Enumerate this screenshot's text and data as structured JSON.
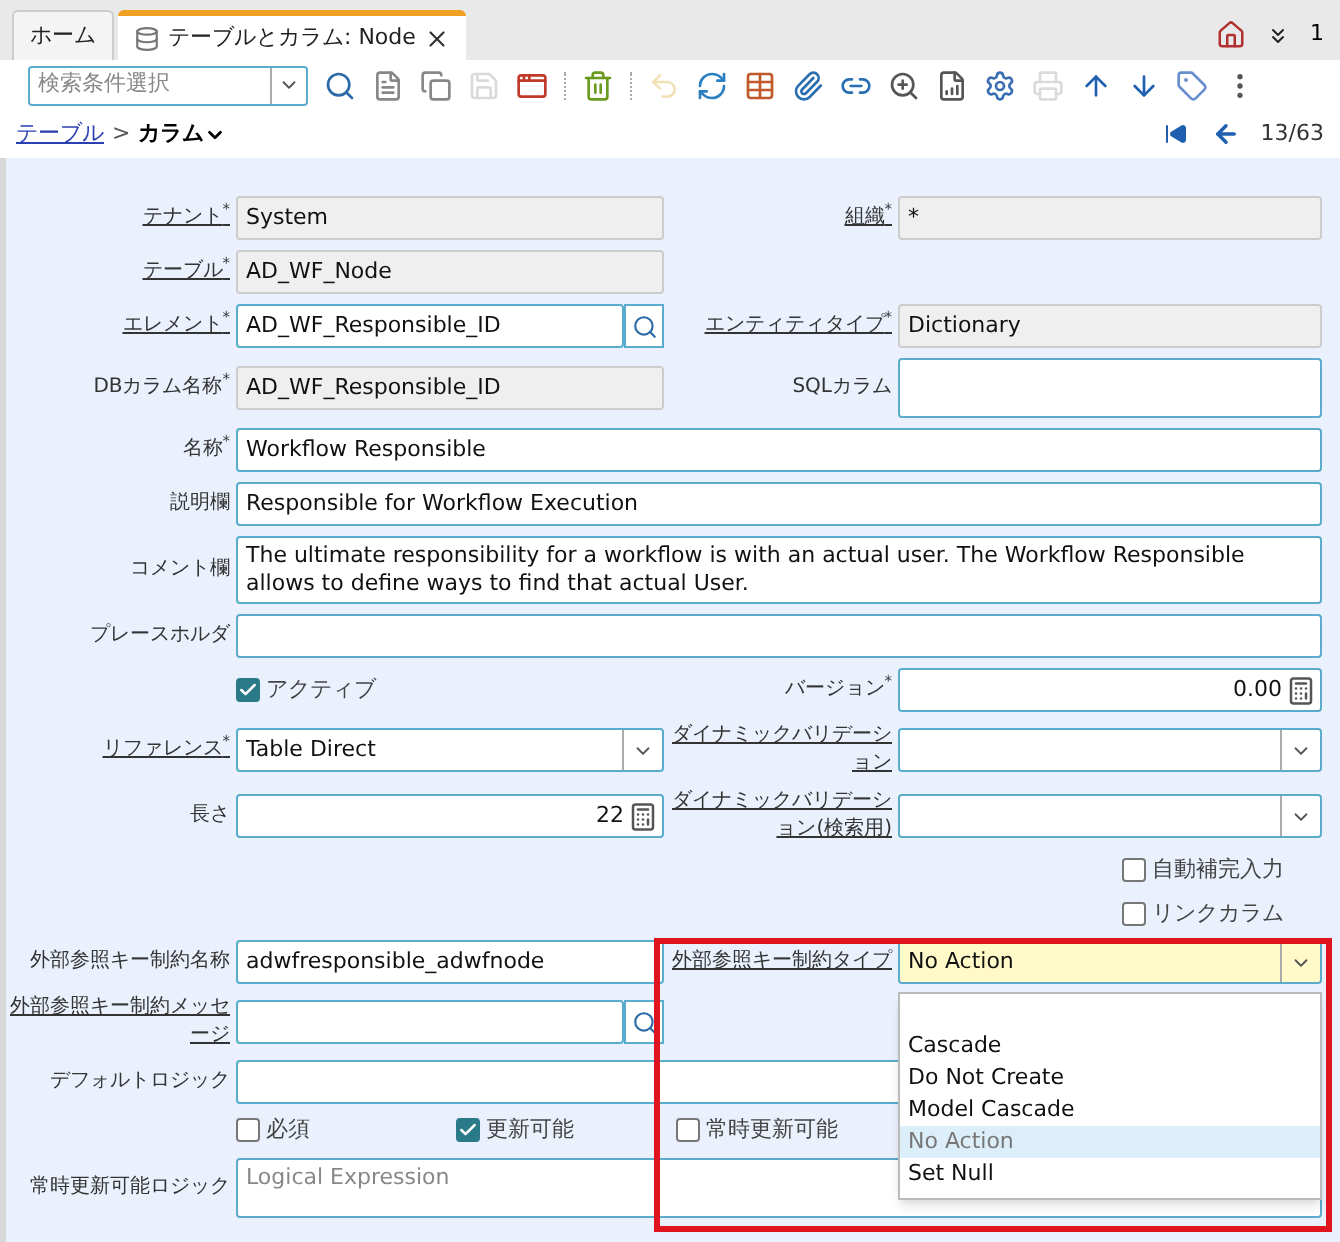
{
  "tabs": [
    {
      "label": "ホーム",
      "selected": false
    },
    {
      "label": "テーブルとカラム: Node",
      "selected": true
    }
  ],
  "window_count": "1",
  "toolbar": {
    "search": {
      "placeholder": "検索条件選択"
    },
    "buttons": [
      {
        "kind": "find",
        "disabled": false
      },
      {
        "kind": "new",
        "disabled": false
      },
      {
        "kind": "copy",
        "disabled": false
      },
      {
        "kind": "save",
        "disabled": true
      },
      {
        "kind": "new-window",
        "disabled": false
      },
      {
        "kind": "sep"
      },
      {
        "kind": "delete",
        "disabled": false
      },
      {
        "kind": "sep"
      },
      {
        "kind": "undo",
        "disabled": true
      },
      {
        "kind": "refresh",
        "disabled": false
      },
      {
        "kind": "grid",
        "disabled": false
      },
      {
        "kind": "attach",
        "disabled": false
      },
      {
        "kind": "attach-up",
        "disabled": false
      },
      {
        "kind": "zoom-across",
        "disabled": false
      },
      {
        "kind": "report",
        "disabled": false
      },
      {
        "kind": "process",
        "disabled": false
      },
      {
        "kind": "print",
        "disabled": true
      },
      {
        "kind": "up",
        "disabled": false
      },
      {
        "kind": "down",
        "disabled": false
      },
      {
        "kind": "tag",
        "disabled": false
      },
      {
        "kind": "more",
        "disabled": false
      }
    ]
  },
  "breadcrumb": {
    "parent": "テーブル",
    "separator": ">",
    "current": "カラム"
  },
  "record_nav": "13/63",
  "form": {
    "rows": [
      {
        "left": {
          "label": "テナント$^{*}$",
          "link": true,
          "kind": "readonly",
          "value": "System"
        },
        "right": {
          "label": "組織$^{*}$",
          "link": true,
          "kind": "readonly",
          "value": "*"
        }
      },
      {
        "left": {
          "label": "テーブル$^{*}$",
          "link": true,
          "kind": "readonly",
          "value": "AD_WF_Node"
        }
      },
      {
        "left": {
          "label": "エレメント$^{*}$",
          "link": true,
          "kind": "search",
          "value": "AD_WF_Responsible_ID"
        },
        "right": {
          "label": "エンティティタイプ$^{*}$",
          "link": true,
          "kind": "readonly",
          "value": "Dictionary"
        }
      },
      {
        "left": {
          "label": "DBカラム名称$^{*}$",
          "link": false,
          "kind": "readonly",
          "value": "AD_WF_Responsible_ID"
        },
        "right": {
          "label": "SQLカラム",
          "link": false,
          "kind": "textarea"
        }
      },
      {
        "full": {
          "label": "名称$^{*}$",
          "link": false,
          "kind": "text",
          "value": "Workflow Responsible"
        }
      },
      {
        "full": {
          "label": "説明欄",
          "link": false,
          "kind": "text",
          "value": "Responsible for Workflow Execution"
        }
      },
      {
        "full": {
          "label": "コメント欄",
          "link": false,
          "kind": "textarea",
          "value": "The ultimate responsibility for a workflow is with an actual user. The Workflow Responsible allows to define ways to find that actual User."
        }
      },
      {
        "full": {
          "label": "プレースホルダ",
          "link": false,
          "kind": "text"
        }
      },
      {
        "left": {
          "kind": "checkbox",
          "label": "アクティブ",
          "checked": true
        },
        "right": {
          "label": "バージョン$^{*}$",
          "link": false,
          "kind": "number",
          "value": "0.00"
        }
      },
      {
        "left": {
          "label": "リファレンス$^{*}$",
          "link": true,
          "kind": "select",
          "value": "Table Direct"
        },
        "right": {
          "label": "ダイナミックバリデーション",
          "link": true,
          "kind": "select"
        }
      },
      {
        "left": {
          "label": "長さ",
          "link": false,
          "kind": "number",
          "value": "22"
        },
        "right": {
          "label": "ダイナミックバリデーション(検索用)",
          "link": true,
          "kind": "select"
        }
      },
      {
        "right": {
          "kind": "checkbox",
          "label": "自動補完入力",
          "checked": false
        }
      },
      {
        "right": {
          "kind": "checkbox",
          "label": "リンクカラム",
          "checked": false
        }
      },
      {
        "left": {
          "label": "外部参照キー制約名称",
          "link": false,
          "kind": "text",
          "value": "adwfresponsible_adwfnode"
        },
        "right": {
          "label": "外部参照キー制約タイプ",
          "link": true,
          "kind": "select",
          "value": "No Action",
          "open": true,
          "outlined": true,
          "options": [
            {
              "label": "Cascade",
              "selected": false
            },
            {
              "label": "Do Not Create",
              "selected": false
            },
            {
              "label": "Model Cascade",
              "selected": false
            },
            {
              "label": "No Action",
              "selected": true
            },
            {
              "label": "Set Null",
              "selected": false
            }
          ]
        }
      },
      {
        "left": {
          "label": "外部参照キー制約メッセージ",
          "link": true,
          "kind": "search"
        }
      },
      {
        "full": {
          "label": "デフォルトロジック",
          "link": false,
          "kind": "text"
        }
      },
      {
        "checks": [
          {
            "kind": "checkbox",
            "label": "必須",
            "checked": false
          },
          {
            "kind": "checkbox",
            "label": "更新可能",
            "checked": true
          },
          {
            "kind": "checkbox",
            "label": "常時更新可能",
            "checked": false
          }
        ]
      },
      {
        "full": {
          "label": "常時更新可能ロジック",
          "link": false,
          "kind": "textarea",
          "placeholder": "Logical Expression"
        }
      }
    ]
  }
}
